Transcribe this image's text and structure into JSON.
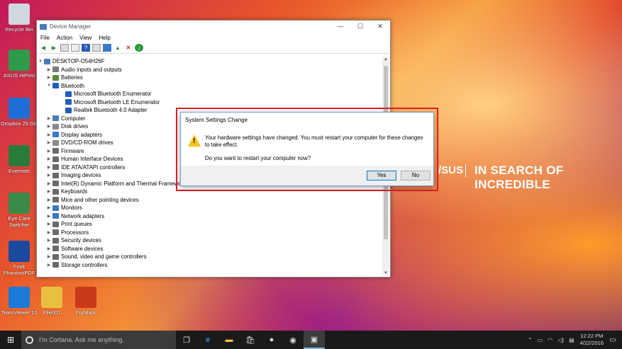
{
  "desktop": {
    "icons": [
      {
        "label": "Recycle Bin",
        "icon": "recycle-bin-icon"
      },
      {
        "label": "ASUS HiPost",
        "icon": "asus-hipost-icon"
      },
      {
        "label": "Dropbox 25 GB",
        "icon": "dropbox-icon"
      },
      {
        "label": "Evernote",
        "icon": "evernote-icon"
      },
      {
        "label": "Eye Care Switcher",
        "icon": "eye-care-icon"
      },
      {
        "label": "Foxit PhantomPDF",
        "icon": "foxit-icon"
      },
      {
        "label": "TeamViewer 10",
        "icon": "teamviewer-icon"
      },
      {
        "label": "File001",
        "icon": "folder-icon"
      },
      {
        "label": "FurMark",
        "icon": "furmark-icon"
      }
    ],
    "wallpaper_tagline": "IN SEARCH OF INCREDIBLE",
    "wallpaper_logo": "/SUS"
  },
  "device_manager": {
    "title": "Device Manager",
    "controls": {
      "minimize": "—",
      "maximize": "☐",
      "close": "✕"
    },
    "menu": [
      "File",
      "Action",
      "View",
      "Help"
    ],
    "tree": {
      "root": "DESKTOP-O54H26F",
      "items": [
        {
          "label": "Audio inputs and outputs",
          "level": 1,
          "expanded": false,
          "color": "#7a7a7a"
        },
        {
          "label": "Batteries",
          "level": 1,
          "expanded": false,
          "color": "#5a8a3a"
        },
        {
          "label": "Bluetooth",
          "level": 1,
          "expanded": true,
          "color": "#1e5fb8"
        },
        {
          "label": "Microsoft Bluetooth Enumerator",
          "level": 2,
          "expanded": null,
          "color": "#1e5fb8"
        },
        {
          "label": "Microsoft Bluetooth LE Enumerator",
          "level": 2,
          "expanded": null,
          "color": "#1e5fb8"
        },
        {
          "label": "Realtek Bluetooth 4.0 Adapter",
          "level": 2,
          "expanded": null,
          "color": "#1e5fb8"
        },
        {
          "label": "Computer",
          "level": 1,
          "expanded": false,
          "color": "#4a7ab8"
        },
        {
          "label": "Disk drives",
          "level": 1,
          "expanded": false,
          "color": "#8a8a8a"
        },
        {
          "label": "Display adapters",
          "level": 1,
          "expanded": false,
          "color": "#3a7ac8"
        },
        {
          "label": "DVD/CD-ROM drives",
          "level": 1,
          "expanded": false,
          "color": "#8a8a8a"
        },
        {
          "label": "Firmware",
          "level": 1,
          "expanded": false,
          "color": "#6a6a6a"
        },
        {
          "label": "Human Interface Devices",
          "level": 1,
          "expanded": false,
          "color": "#6a6a6a"
        },
        {
          "label": "IDE ATA/ATAPI controllers",
          "level": 1,
          "expanded": false,
          "color": "#6a6a6a"
        },
        {
          "label": "Imaging devices",
          "level": 1,
          "expanded": false,
          "color": "#6a6a6a"
        },
        {
          "label": "Intel(R) Dynamic Platform and Thermal Framework",
          "level": 1,
          "expanded": false,
          "color": "#6a6a6a"
        },
        {
          "label": "Keyboards",
          "level": 1,
          "expanded": false,
          "color": "#6a6a6a"
        },
        {
          "label": "Mice and other pointing devices",
          "level": 1,
          "expanded": false,
          "color": "#6a6a6a"
        },
        {
          "label": "Monitors",
          "level": 1,
          "expanded": false,
          "color": "#3a7ac8"
        },
        {
          "label": "Network adapters",
          "level": 1,
          "expanded": false,
          "color": "#3a7ac8"
        },
        {
          "label": "Print queues",
          "level": 1,
          "expanded": false,
          "color": "#6a6a6a"
        },
        {
          "label": "Processors",
          "level": 1,
          "expanded": false,
          "color": "#6a6a6a"
        },
        {
          "label": "Security devices",
          "level": 1,
          "expanded": false,
          "color": "#6a6a6a"
        },
        {
          "label": "Software devices",
          "level": 1,
          "expanded": false,
          "color": "#6a6a6a"
        },
        {
          "label": "Sound, video and game controllers",
          "level": 1,
          "expanded": false,
          "color": "#6a6a6a"
        },
        {
          "label": "Storage controllers",
          "level": 1,
          "expanded": false,
          "color": "#6a6a6a"
        }
      ]
    }
  },
  "dialog": {
    "title": "System Settings Change",
    "message": "Your hardware settings have changed. You must restart your computer for these changes to take effect.",
    "question": "Do you want to restart your computer now?",
    "yes_label": "Yes",
    "no_label": "No"
  },
  "taskbar": {
    "search_placeholder": "I'm Cortana. Ask me anything.",
    "time": "12:22 PM",
    "date": "4/22/2016"
  }
}
